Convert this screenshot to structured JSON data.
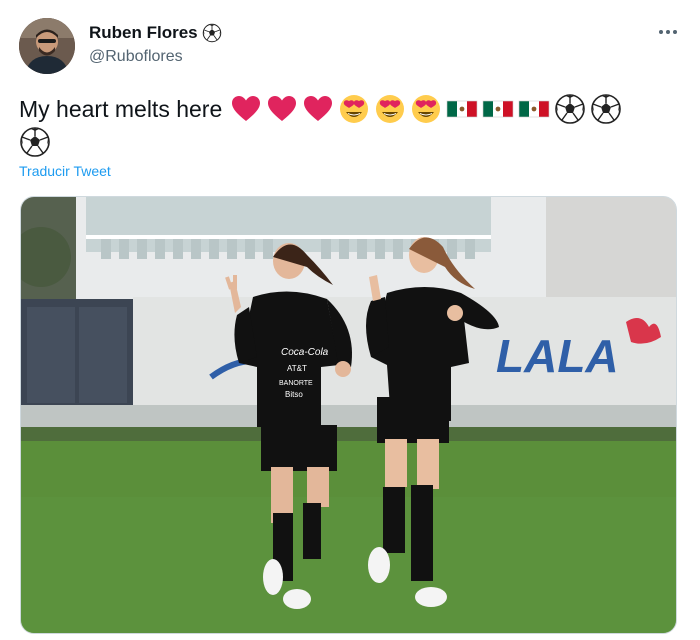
{
  "user": {
    "name": "Ruben Flores",
    "handle": "@Ruboflores",
    "name_emoji": "soccer-ball-icon"
  },
  "tweet": {
    "text": "My heart melts here",
    "emojis_line1": [
      "red-heart-icon",
      "red-heart-icon",
      "red-heart-icon",
      "heart-eyes-face-icon",
      "heart-eyes-face-icon",
      "heart-eyes-face-icon",
      "mexico-flag-icon",
      "mexico-flag-icon",
      "mexico-flag-icon",
      "soccer-ball-icon",
      "soccer-ball-icon"
    ],
    "emojis_line2": [
      "soccer-ball-icon"
    ],
    "translate_label": "Traducir Tweet"
  },
  "media": {
    "kind": "photo",
    "banner_text": "LALA",
    "jersey_sponsor_1": "Coca-Cola",
    "jersey_sponsor_2": "AT&T",
    "jersey_sponsor_3": "BANORTE",
    "jersey_sponsor_4": "Bitso"
  },
  "colors": {
    "link": "#1d9bf0",
    "secondary_text": "#536471",
    "heart": "#e0245e",
    "grass": "#5b8f3a",
    "banner_blue": "#2f5fa8"
  }
}
